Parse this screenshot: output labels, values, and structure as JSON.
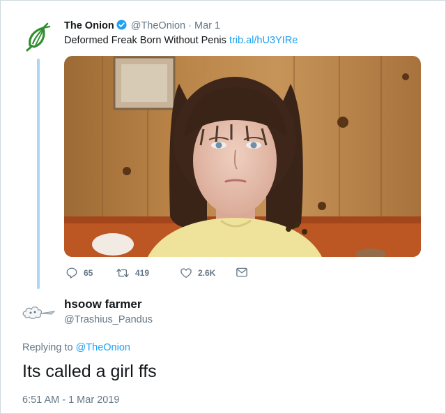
{
  "original_tweet": {
    "author_name": "The Onion",
    "handle": "@TheOnion",
    "separator": "·",
    "date": "Mar 1",
    "text": "Deformed Freak Born Without Penis",
    "link": "trib.al/hU3YIRe",
    "stats": {
      "replies": "65",
      "retweets": "419",
      "likes": "2.6K"
    }
  },
  "reply": {
    "author_name": "hsoow farmer",
    "handle": "@Trashius_Pandus",
    "replying_prefix": "Replying to",
    "replying_to": "@TheOnion",
    "text": "Its called a girl ffs",
    "timestamp": "6:51 AM - 1 Mar 2019"
  },
  "colors": {
    "link_blue": "#1da1f2",
    "onion_green": "#2f8f2f",
    "thread_line": "#a9d7f7",
    "muted_text": "#657786"
  },
  "icons": [
    "onion-logo-icon",
    "verified-badge-icon",
    "reply-icon",
    "retweet-icon",
    "like-icon",
    "message-icon",
    "cloud-avatar-icon"
  ]
}
